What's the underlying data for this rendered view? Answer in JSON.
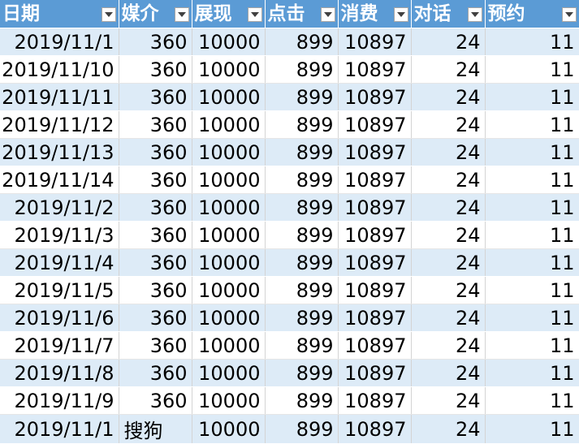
{
  "sheet": {
    "headers": [
      "日期",
      "媒介",
      "展现",
      "点击",
      "消费",
      "对话",
      "预约"
    ],
    "rows": [
      [
        "2019/11/1",
        "360",
        "10000",
        "899",
        "10897",
        "24",
        "11"
      ],
      [
        "2019/11/10",
        "360",
        "10000",
        "899",
        "10897",
        "24",
        "11"
      ],
      [
        "2019/11/11",
        "360",
        "10000",
        "899",
        "10897",
        "24",
        "11"
      ],
      [
        "2019/11/12",
        "360",
        "10000",
        "899",
        "10897",
        "24",
        "11"
      ],
      [
        "2019/11/13",
        "360",
        "10000",
        "899",
        "10897",
        "24",
        "11"
      ],
      [
        "2019/11/14",
        "360",
        "10000",
        "899",
        "10897",
        "24",
        "11"
      ],
      [
        "2019/11/2",
        "360",
        "10000",
        "899",
        "10897",
        "24",
        "11"
      ],
      [
        "2019/11/3",
        "360",
        "10000",
        "899",
        "10897",
        "24",
        "11"
      ],
      [
        "2019/11/4",
        "360",
        "10000",
        "899",
        "10897",
        "24",
        "11"
      ],
      [
        "2019/11/5",
        "360",
        "10000",
        "899",
        "10897",
        "24",
        "11"
      ],
      [
        "2019/11/6",
        "360",
        "10000",
        "899",
        "10897",
        "24",
        "11"
      ],
      [
        "2019/11/7",
        "360",
        "10000",
        "899",
        "10897",
        "24",
        "11"
      ],
      [
        "2019/11/8",
        "360",
        "10000",
        "899",
        "10897",
        "24",
        "11"
      ],
      [
        "2019/11/9",
        "360",
        "10000",
        "899",
        "10897",
        "24",
        "11"
      ],
      [
        "2019/11/1",
        "搜狗",
        "10000",
        "899",
        "10897",
        "24",
        "11"
      ]
    ]
  },
  "colors": {
    "header_bg": "#5b9bd5",
    "band_bg": "#ddebf7",
    "header_text": "#ffffff"
  },
  "icons": {
    "filter": "filter-dropdown-icon"
  }
}
